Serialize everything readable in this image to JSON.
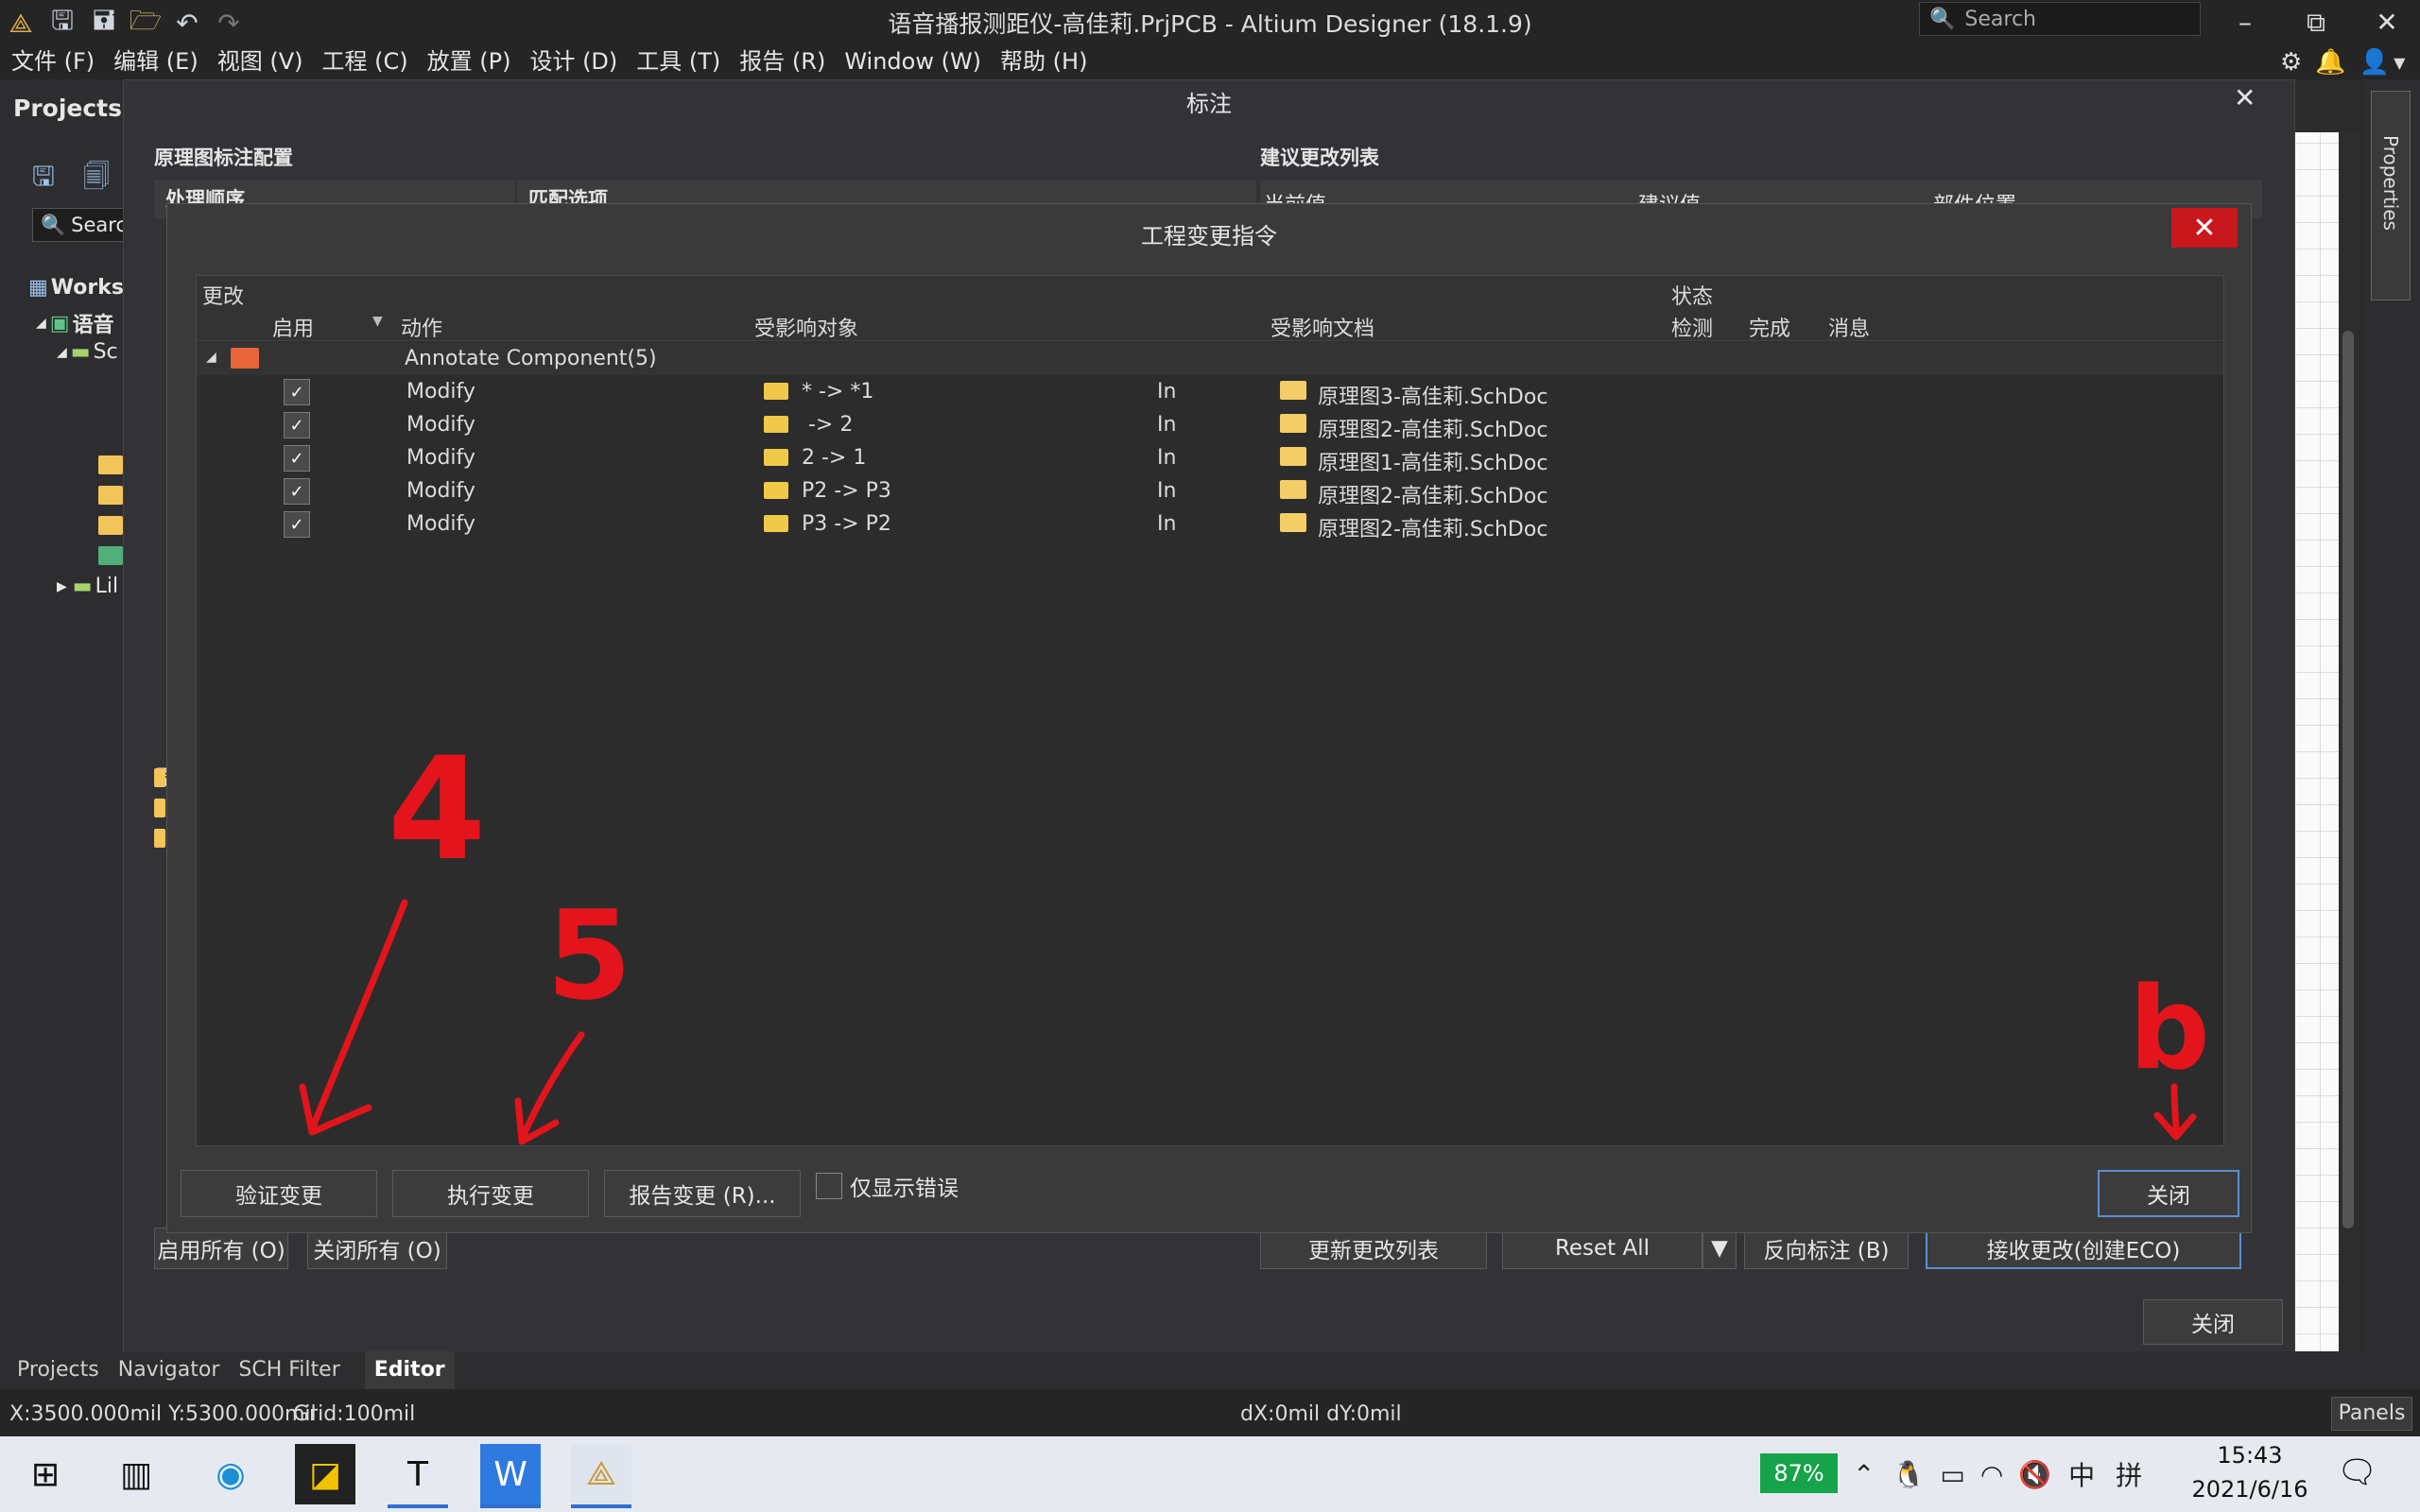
{
  "window": {
    "title": "语音播报测距仪-高佳莉.PrjPCB - Altium Designer (18.1.9)",
    "search_placeholder": "Search"
  },
  "menu": [
    "文件 (F)",
    "编辑 (E)",
    "视图 (V)",
    "工程 (C)",
    "放置 (P)",
    "设计 (D)",
    "工具 (T)",
    "报告 (R)",
    "Window (W)",
    "帮助 (H)"
  ],
  "projects_panel": {
    "title": "Projects",
    "search": "Searc",
    "tree": [
      "Works",
      "语音",
      "Sc",
      "Lil"
    ]
  },
  "right_panel": {
    "properties": "Properties"
  },
  "annotate": {
    "title": "标注",
    "config_label": "原理图标注配置",
    "order_tab": "处理顺序",
    "match_tab": "匹配选项",
    "change_list_label": "建议更改列表",
    "columns": [
      "当前值",
      "建议值",
      "部件位置"
    ],
    "enable_all": "启用所有 (O)",
    "disable_all": "关闭所有 (O)",
    "update_list": "更新更改列表",
    "reset_all": "Reset All",
    "back_annotate": "反向标注 (B)",
    "accept_changes": "接收更改(创建ECO)",
    "close": "关闭"
  },
  "eco": {
    "title": "工程变更指令",
    "group_change": "更改",
    "group_status": "状态",
    "columns": {
      "enable": "启用",
      "action": "动作",
      "affected_object": "受影响对象",
      "affected_doc": "受影响文档",
      "check": "检测",
      "done": "完成",
      "message": "消息"
    },
    "group_row": "Annotate Component(5)",
    "rows": [
      {
        "action": "Modify",
        "object": "* -> *1",
        "in": "In",
        "doc": "原理图3-高佳莉.SchDoc"
      },
      {
        "action": "Modify",
        "object": " -> 2",
        "in": "In",
        "doc": "原理图2-高佳莉.SchDoc"
      },
      {
        "action": "Modify",
        "object": "2 -> 1",
        "in": "In",
        "doc": "原理图1-高佳莉.SchDoc"
      },
      {
        "action": "Modify",
        "object": "P2 -> P3",
        "in": "In",
        "doc": "原理图2-高佳莉.SchDoc"
      },
      {
        "action": "Modify",
        "object": "P3 -> P2",
        "in": "In",
        "doc": "原理图2-高佳莉.SchDoc"
      }
    ],
    "validate": "验证变更",
    "execute": "执行变更",
    "report": "报告变更 (R)...",
    "only_errors": "仅显示错误",
    "close": "关闭"
  },
  "annotations": [
    "4",
    "5",
    "b"
  ],
  "bottom_tabs": [
    "Projects",
    "Navigator",
    "SCH Filter",
    "Editor"
  ],
  "status": {
    "coords": "X:3500.000mil Y:5300.000mil",
    "grid": "Grid:100mil",
    "delta": "dX:0mil dY:0mil",
    "panels": "Panels"
  },
  "taskbar": {
    "battery": "87%",
    "ime1": "中",
    "ime2": "拼",
    "time": "15:43",
    "date": "2021/6/16"
  },
  "colors": {
    "accent": "#5b8fd0",
    "close_red": "#c8181e",
    "annotation_red": "#e3141c"
  }
}
